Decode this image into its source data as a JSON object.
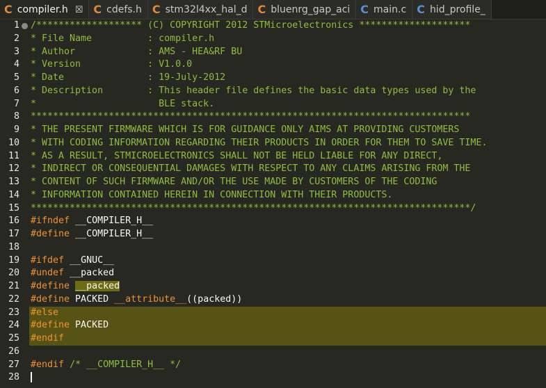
{
  "tabs": [
    {
      "label": "compiler.h",
      "icon": "c-file-icon",
      "color": "orange",
      "active": true,
      "close": "☒"
    },
    {
      "label": "cdefs.h",
      "icon": "c-file-icon",
      "color": "orange",
      "active": false
    },
    {
      "label": "stm32l4xx_hal_d",
      "icon": "c-file-icon",
      "color": "orange",
      "active": false
    },
    {
      "label": "bluenrg_gap_aci",
      "icon": "c-file-icon",
      "color": "orange",
      "active": false
    },
    {
      "label": "main.c",
      "icon": "c-source-icon",
      "color": "blue",
      "active": false
    },
    {
      "label": "hid_profile_",
      "icon": "c-source-icon",
      "color": "blue",
      "active": false
    }
  ],
  "colors": {
    "background": "#272822",
    "comment": "#8fbe3c",
    "keyword": "#f0922f",
    "highlight": "#575315"
  },
  "lines": [
    {
      "n": "1",
      "fold": true,
      "parts": [
        {
          "t": "/******************* (C) COPYRIGHT 2012 STMicroelectronics ********************",
          "c": "cmt"
        }
      ]
    },
    {
      "n": "2",
      "parts": [
        {
          "t": "* File Name          : compiler.h",
          "c": "cmt"
        }
      ]
    },
    {
      "n": "3",
      "parts": [
        {
          "t": "* Author             : AMS - HEA&RF BU",
          "c": "cmt"
        }
      ]
    },
    {
      "n": "4",
      "parts": [
        {
          "t": "* Version            : V1.0.0",
          "c": "cmt"
        }
      ]
    },
    {
      "n": "5",
      "parts": [
        {
          "t": "* Date               : 19-July-2012",
          "c": "cmt"
        }
      ]
    },
    {
      "n": "6",
      "parts": [
        {
          "t": "* Description        : This header file defines the basic data types used by the",
          "c": "cmt"
        }
      ]
    },
    {
      "n": "7",
      "parts": [
        {
          "t": "*                      BLE stack.",
          "c": "cmt"
        }
      ]
    },
    {
      "n": "8",
      "parts": [
        {
          "t": "*******************************************************************************",
          "c": "cmt"
        }
      ]
    },
    {
      "n": "9",
      "parts": [
        {
          "t": "* THE PRESENT FIRMWARE WHICH IS FOR GUIDANCE ONLY AIMS AT PROVIDING CUSTOMERS",
          "c": "cmt"
        }
      ]
    },
    {
      "n": "10",
      "parts": [
        {
          "t": "* WITH CODING INFORMATION REGARDING THEIR PRODUCTS IN ORDER FOR THEM TO SAVE TIME.",
          "c": "cmt"
        }
      ]
    },
    {
      "n": "11",
      "parts": [
        {
          "t": "* AS A RESULT, STMICROELECTRONICS SHALL NOT BE HELD LIABLE FOR ANY DIRECT,",
          "c": "cmt"
        }
      ]
    },
    {
      "n": "12",
      "parts": [
        {
          "t": "* INDIRECT OR CONSEQUENTIAL DAMAGES WITH RESPECT TO ANY CLAIMS ARISING FROM THE",
          "c": "cmt"
        }
      ]
    },
    {
      "n": "13",
      "parts": [
        {
          "t": "* CONTENT OF SUCH FIRMWARE AND/OR THE USE MADE BY CUSTOMERS OF THE CODING",
          "c": "cmt"
        }
      ]
    },
    {
      "n": "14",
      "parts": [
        {
          "t": "* INFORMATION CONTAINED HEREIN IN CONNECTION WITH THEIR PRODUCTS.",
          "c": "cmt"
        }
      ]
    },
    {
      "n": "15",
      "parts": [
        {
          "t": "*******************************************************************************/",
          "c": "cmt"
        }
      ]
    },
    {
      "n": "16",
      "parts": [
        {
          "t": "#ifndef",
          "c": "kw"
        },
        {
          "t": " __COMPILER_H__",
          "c": ""
        }
      ]
    },
    {
      "n": "17",
      "parts": [
        {
          "t": "#define",
          "c": "kw"
        },
        {
          "t": " __COMPILER_H__",
          "c": ""
        }
      ]
    },
    {
      "n": "18",
      "parts": []
    },
    {
      "n": "19",
      "parts": [
        {
          "t": "#ifdef",
          "c": "kw"
        },
        {
          "t": " __GNUC__",
          "c": ""
        }
      ]
    },
    {
      "n": "20",
      "parts": [
        {
          "t": "#undef",
          "c": "kw"
        },
        {
          "t": " __packed",
          "c": ""
        }
      ]
    },
    {
      "n": "21",
      "parts": [
        {
          "t": "#define",
          "c": "kw"
        },
        {
          "t": " ",
          "c": ""
        },
        {
          "t": "__packed",
          "c": "mark"
        }
      ]
    },
    {
      "n": "22",
      "parts": [
        {
          "t": "#define",
          "c": "kw"
        },
        {
          "t": " PACKED ",
          "c": ""
        },
        {
          "t": "__attribute__",
          "c": "kw"
        },
        {
          "t": "((packed))",
          "c": ""
        }
      ]
    },
    {
      "n": "23",
      "hl": true,
      "parts": [
        {
          "t": "#else",
          "c": "kw"
        }
      ]
    },
    {
      "n": "24",
      "hl": true,
      "parts": [
        {
          "t": "#define",
          "c": "kw"
        },
        {
          "t": " PACKED",
          "c": ""
        }
      ]
    },
    {
      "n": "25",
      "hl": true,
      "parts": [
        {
          "t": "#endif",
          "c": "kw"
        }
      ]
    },
    {
      "n": "26",
      "parts": []
    },
    {
      "n": "27",
      "parts": [
        {
          "t": "#endif",
          "c": "kw"
        },
        {
          "t": " ",
          "c": ""
        },
        {
          "t": "/* __COMPILER_H__ */",
          "c": "cmt"
        }
      ]
    },
    {
      "n": "28",
      "cursor": true,
      "parts": []
    }
  ]
}
